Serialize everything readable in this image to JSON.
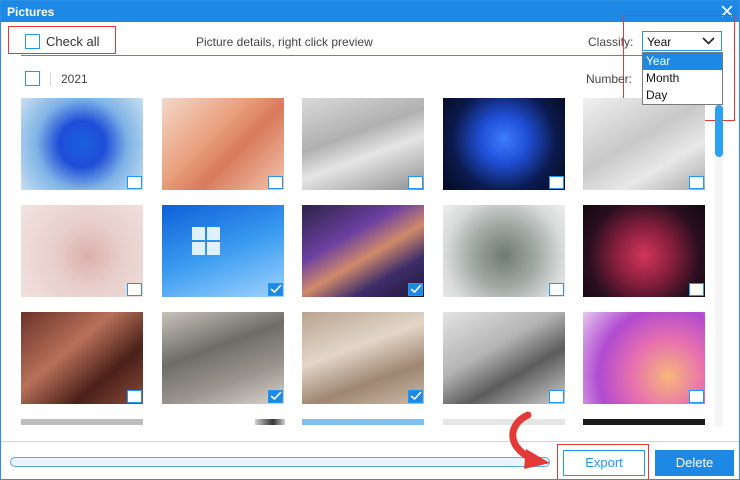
{
  "window": {
    "title": "Pictures"
  },
  "toolbar": {
    "check_all_label": "Check all",
    "hint": "Picture details, right click preview",
    "classify_label": "Classify:",
    "classify_value": "Year",
    "classify_options": [
      "Year",
      "Month",
      "Day"
    ]
  },
  "group": {
    "year": "2021",
    "number_label": "Number:"
  },
  "thumbnails": [
    {
      "desc": "blue bloom",
      "checked": false
    },
    {
      "desc": "peach silk",
      "checked": false
    },
    {
      "desc": "blurred desk",
      "checked": false
    },
    {
      "desc": "dark blue bloom",
      "checked": false
    },
    {
      "desc": "blurred room",
      "checked": false
    },
    {
      "desc": "pink petals",
      "checked": false
    },
    {
      "desc": "windows logo",
      "checked": true
    },
    {
      "desc": "purple wave",
      "checked": true
    },
    {
      "desc": "gray ribbon",
      "checked": false
    },
    {
      "desc": "dark red ribbon",
      "checked": false
    },
    {
      "desc": "brown silk",
      "checked": false
    },
    {
      "desc": "blurred tablet",
      "checked": true
    },
    {
      "desc": "blurred printer",
      "checked": true
    },
    {
      "desc": "blurred office",
      "checked": false
    },
    {
      "desc": "pink curves",
      "checked": false
    }
  ],
  "footer": {
    "export_label": "Export",
    "delete_label": "Delete"
  },
  "colors": {
    "accent": "#1e88e5",
    "highlight": "#e53935"
  }
}
